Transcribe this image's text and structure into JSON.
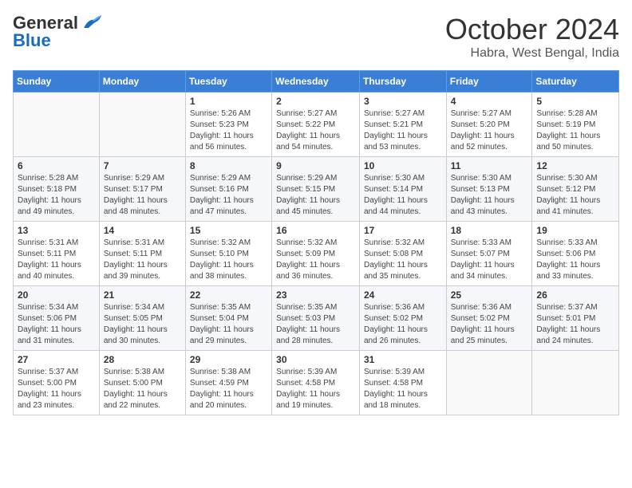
{
  "logo": {
    "general": "General",
    "blue": "Blue"
  },
  "title": "October 2024",
  "location": "Habra, West Bengal, India",
  "headers": [
    "Sunday",
    "Monday",
    "Tuesday",
    "Wednesday",
    "Thursday",
    "Friday",
    "Saturday"
  ],
  "weeks": [
    [
      {
        "day": "",
        "info": ""
      },
      {
        "day": "",
        "info": ""
      },
      {
        "day": "1",
        "info": "Sunrise: 5:26 AM\nSunset: 5:23 PM\nDaylight: 11 hours and 56 minutes."
      },
      {
        "day": "2",
        "info": "Sunrise: 5:27 AM\nSunset: 5:22 PM\nDaylight: 11 hours and 54 minutes."
      },
      {
        "day": "3",
        "info": "Sunrise: 5:27 AM\nSunset: 5:21 PM\nDaylight: 11 hours and 53 minutes."
      },
      {
        "day": "4",
        "info": "Sunrise: 5:27 AM\nSunset: 5:20 PM\nDaylight: 11 hours and 52 minutes."
      },
      {
        "day": "5",
        "info": "Sunrise: 5:28 AM\nSunset: 5:19 PM\nDaylight: 11 hours and 50 minutes."
      }
    ],
    [
      {
        "day": "6",
        "info": "Sunrise: 5:28 AM\nSunset: 5:18 PM\nDaylight: 11 hours and 49 minutes."
      },
      {
        "day": "7",
        "info": "Sunrise: 5:29 AM\nSunset: 5:17 PM\nDaylight: 11 hours and 48 minutes."
      },
      {
        "day": "8",
        "info": "Sunrise: 5:29 AM\nSunset: 5:16 PM\nDaylight: 11 hours and 47 minutes."
      },
      {
        "day": "9",
        "info": "Sunrise: 5:29 AM\nSunset: 5:15 PM\nDaylight: 11 hours and 45 minutes."
      },
      {
        "day": "10",
        "info": "Sunrise: 5:30 AM\nSunset: 5:14 PM\nDaylight: 11 hours and 44 minutes."
      },
      {
        "day": "11",
        "info": "Sunrise: 5:30 AM\nSunset: 5:13 PM\nDaylight: 11 hours and 43 minutes."
      },
      {
        "day": "12",
        "info": "Sunrise: 5:30 AM\nSunset: 5:12 PM\nDaylight: 11 hours and 41 minutes."
      }
    ],
    [
      {
        "day": "13",
        "info": "Sunrise: 5:31 AM\nSunset: 5:11 PM\nDaylight: 11 hours and 40 minutes."
      },
      {
        "day": "14",
        "info": "Sunrise: 5:31 AM\nSunset: 5:11 PM\nDaylight: 11 hours and 39 minutes."
      },
      {
        "day": "15",
        "info": "Sunrise: 5:32 AM\nSunset: 5:10 PM\nDaylight: 11 hours and 38 minutes."
      },
      {
        "day": "16",
        "info": "Sunrise: 5:32 AM\nSunset: 5:09 PM\nDaylight: 11 hours and 36 minutes."
      },
      {
        "day": "17",
        "info": "Sunrise: 5:32 AM\nSunset: 5:08 PM\nDaylight: 11 hours and 35 minutes."
      },
      {
        "day": "18",
        "info": "Sunrise: 5:33 AM\nSunset: 5:07 PM\nDaylight: 11 hours and 34 minutes."
      },
      {
        "day": "19",
        "info": "Sunrise: 5:33 AM\nSunset: 5:06 PM\nDaylight: 11 hours and 33 minutes."
      }
    ],
    [
      {
        "day": "20",
        "info": "Sunrise: 5:34 AM\nSunset: 5:06 PM\nDaylight: 11 hours and 31 minutes."
      },
      {
        "day": "21",
        "info": "Sunrise: 5:34 AM\nSunset: 5:05 PM\nDaylight: 11 hours and 30 minutes."
      },
      {
        "day": "22",
        "info": "Sunrise: 5:35 AM\nSunset: 5:04 PM\nDaylight: 11 hours and 29 minutes."
      },
      {
        "day": "23",
        "info": "Sunrise: 5:35 AM\nSunset: 5:03 PM\nDaylight: 11 hours and 28 minutes."
      },
      {
        "day": "24",
        "info": "Sunrise: 5:36 AM\nSunset: 5:02 PM\nDaylight: 11 hours and 26 minutes."
      },
      {
        "day": "25",
        "info": "Sunrise: 5:36 AM\nSunset: 5:02 PM\nDaylight: 11 hours and 25 minutes."
      },
      {
        "day": "26",
        "info": "Sunrise: 5:37 AM\nSunset: 5:01 PM\nDaylight: 11 hours and 24 minutes."
      }
    ],
    [
      {
        "day": "27",
        "info": "Sunrise: 5:37 AM\nSunset: 5:00 PM\nDaylight: 11 hours and 23 minutes."
      },
      {
        "day": "28",
        "info": "Sunrise: 5:38 AM\nSunset: 5:00 PM\nDaylight: 11 hours and 22 minutes."
      },
      {
        "day": "29",
        "info": "Sunrise: 5:38 AM\nSunset: 4:59 PM\nDaylight: 11 hours and 20 minutes."
      },
      {
        "day": "30",
        "info": "Sunrise: 5:39 AM\nSunset: 4:58 PM\nDaylight: 11 hours and 19 minutes."
      },
      {
        "day": "31",
        "info": "Sunrise: 5:39 AM\nSunset: 4:58 PM\nDaylight: 11 hours and 18 minutes."
      },
      {
        "day": "",
        "info": ""
      },
      {
        "day": "",
        "info": ""
      }
    ]
  ]
}
